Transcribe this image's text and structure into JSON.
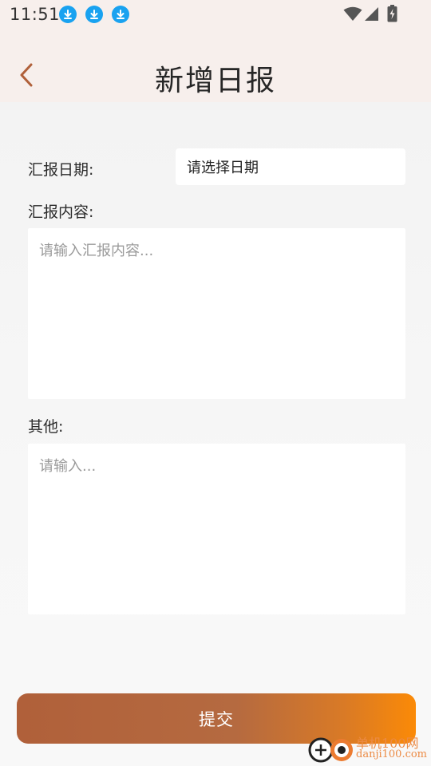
{
  "status_bar": {
    "time": "11:51"
  },
  "header": {
    "title": "新增日报"
  },
  "form": {
    "date_label": "汇报日期:",
    "date_value": "请选择日期",
    "content_label": "汇报内容:",
    "content_placeholder": "请输入汇报内容...",
    "other_label": "其他:",
    "other_placeholder": "请输入..."
  },
  "actions": {
    "submit_label": "提交"
  },
  "watermark": {
    "line1": "单机100网",
    "line2": "danji100.com"
  },
  "colors": {
    "accent": "#b0603a",
    "accent_end": "#fb8a07",
    "header_bg": "#f7efec",
    "download_icon": "#19a2f0"
  }
}
